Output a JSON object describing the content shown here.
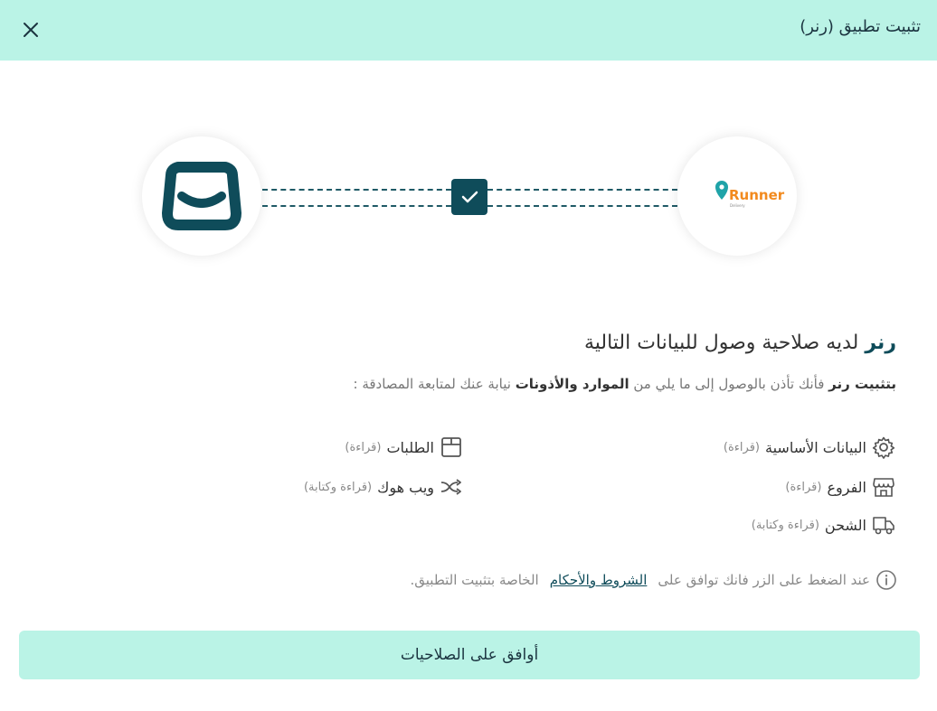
{
  "header": {
    "title": "تثبيت تطبيق (رنر)",
    "close_icon": "close-icon"
  },
  "connection": {
    "left_logo": "salla-logo",
    "right_logo_text": "Runner",
    "right_logo_subtext": "Delivery",
    "check_icon": "check-icon"
  },
  "permissions": {
    "title_app": "رنر",
    "title_rest": " لديه صلاحية وصول للبيانات التالية",
    "desc_p1": "بتثبيت رنر",
    "desc_p2": " فأنك تأذن بالوصول إلى ما يلي من ",
    "desc_p3": "الموارد والأذونات",
    "desc_p4": " نيابة عنك لمتابعة المصادقة :",
    "items": [
      {
        "name": "البيانات الأساسية",
        "access": "(قراءة)",
        "icon": "gear-icon"
      },
      {
        "name": "الطلبات",
        "access": "(قراءة)",
        "icon": "box-icon"
      },
      {
        "name": "الفروع",
        "access": "(قراءة)",
        "icon": "store-icon"
      },
      {
        "name": "ويب هوك",
        "access": "(قراءة وكتابة)",
        "icon": "webhook-icon"
      },
      {
        "name": "الشحن",
        "access": "(قراءة وكتابة)",
        "icon": "truck-icon"
      }
    ]
  },
  "terms": {
    "prefix": "عند الضغط على الزر فانك توافق على",
    "link": "الشروط والأحكام",
    "suffix": "الخاصة بتثبيت التطبيق.",
    "icon": "info-icon"
  },
  "agree_button": {
    "label": "أوافق على الصلاحيات"
  }
}
